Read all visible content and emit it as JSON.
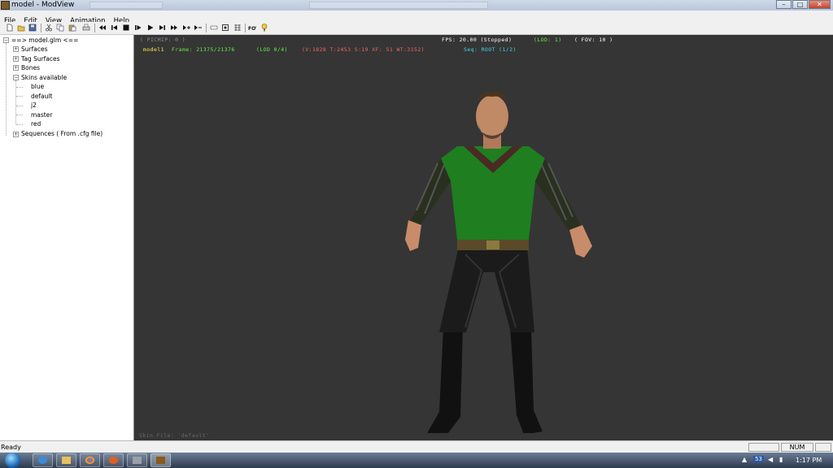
{
  "window": {
    "title": "model - ModView"
  },
  "window_controls": {
    "minimize": "–",
    "maximize": "□",
    "close": "✕"
  },
  "menu": [
    "File",
    "Edit",
    "View",
    "Animation",
    "Help"
  ],
  "toolbar_icons": [
    "new-file-icon",
    "open-folder-icon",
    "save-icon",
    "cut-icon",
    "copy-icon",
    "paste-icon",
    "print-icon",
    "rewind-icon",
    "step-back-icon",
    "stop-icon",
    "play-icon",
    "step-forward-icon",
    "fast-forward-icon",
    "lod-up-icon",
    "lod-down-icon",
    "bbox-icon",
    "wireframe-icon",
    "normals-icon",
    "fov-icon",
    "help-icon"
  ],
  "tree": {
    "root": "==> model.glm <==",
    "nodes": [
      "Surfaces",
      "Tag Surfaces",
      "Bones",
      "Skins available",
      "Sequences ( From .cfg file)"
    ],
    "skins": [
      "blue",
      "default",
      "j2",
      "master",
      "red"
    ]
  },
  "hud": {
    "picmip": "( PICMIP: 0 )",
    "fps": "FPS: 20.00 (Stopped)",
    "lod": "(LOD: 1)",
    "fov": "( FOV: 10 )",
    "model": "model1",
    "frame": "Frame: 21375/21376",
    "lod_of": "(LOD 0/4)",
    "verts": "(V:1828 T:2453 S:19 XF: 51 WT:3152)",
    "seq": "Seq: ROOT (1/2)",
    "skin_file": "Skin File: 'default'"
  },
  "colors": {
    "viewport_bg": "#353535",
    "hud_white": "#ffffff",
    "hud_yellow": "#ffee44",
    "hud_green": "#66ee44",
    "hud_red": "#ee6666",
    "hud_cyan": "#44d8e8",
    "hud_grey": "#8a8a8a"
  },
  "status": {
    "text": "Ready",
    "num": "NUM"
  },
  "taskbar": {
    "time": "1:17 PM",
    "badge": "53"
  }
}
